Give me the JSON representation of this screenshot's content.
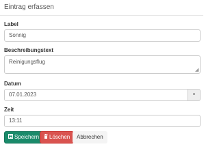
{
  "form": {
    "title": "Eintrag erfassen",
    "label": {
      "label": "Label",
      "value": "Sonnig"
    },
    "description": {
      "label": "Beschreibungstext",
      "value": "Reinigungsflug"
    },
    "date": {
      "label": "Datum",
      "value": "07.01.2023",
      "clear_glyph": "×"
    },
    "time": {
      "label": "Zeit",
      "value": "13:11"
    }
  },
  "buttons": {
    "save": {
      "label": "Speichern",
      "icon": "save-icon",
      "color": "#1a8a6a"
    },
    "delete": {
      "label": "Löschen",
      "icon": "trash-icon",
      "color": "#d9534f"
    },
    "cancel": {
      "label": "Abbrechen"
    }
  }
}
